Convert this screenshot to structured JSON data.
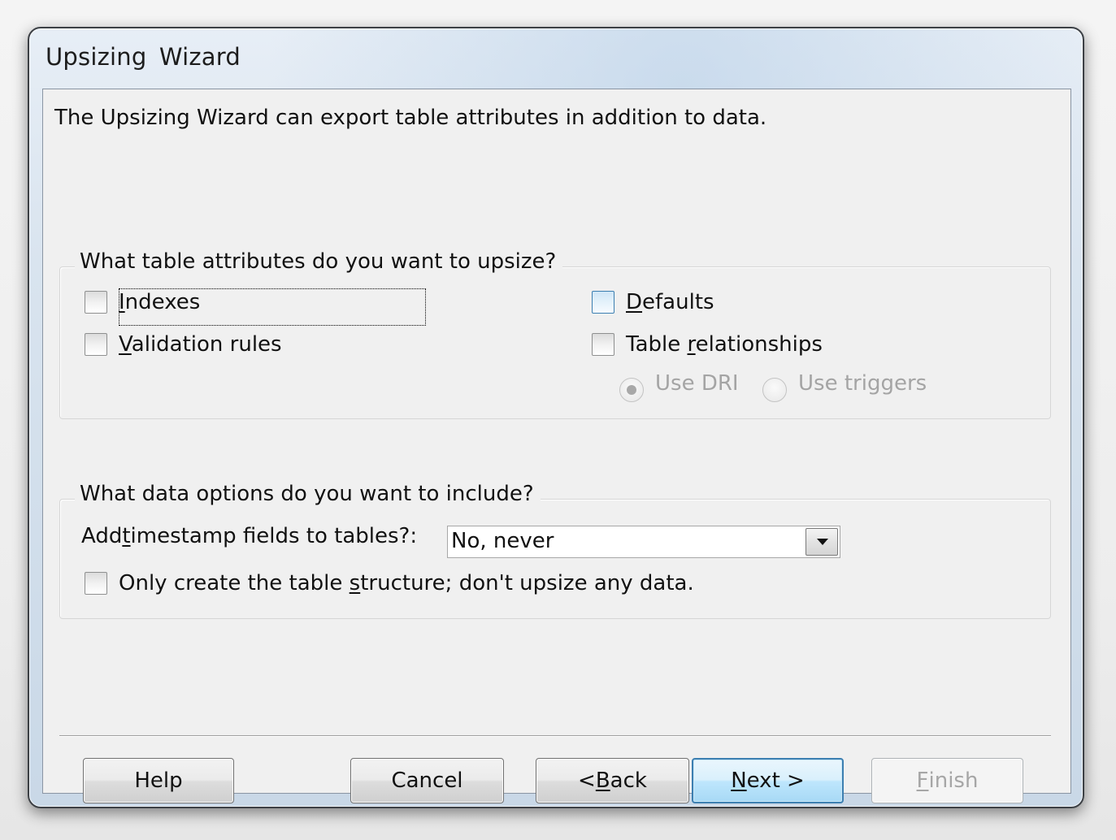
{
  "window": {
    "title": "Upsizing  Wizard"
  },
  "intro_text": "The Upsizing Wizard can export table attributes in addition to data.",
  "attributes_group": {
    "legend": "What table attributes do you want to upsize?",
    "options": [
      {
        "label": "Indexes",
        "checked": false
      },
      {
        "label": "Validation rules",
        "checked": false
      },
      {
        "label": "Defaults",
        "checked": false
      },
      {
        "label": "Table relationships",
        "checked": false
      }
    ],
    "radios": [
      {
        "label": "Use DRI",
        "selected": true,
        "enabled": false
      },
      {
        "label": "Use triggers",
        "selected": false,
        "enabled": false
      }
    ]
  },
  "data_group": {
    "legend": "What data options do you want to include?",
    "timestamp_label": "Add timestamp fields to tables?:",
    "timestamp_value": "No, never",
    "structure_only_label": "Only create the table structure; don't upsize any data.",
    "structure_only_checked": false
  },
  "buttons": {
    "help": "Help",
    "cancel": "Cancel",
    "back": "< Back",
    "next": "Next >",
    "finish": "Finish"
  }
}
